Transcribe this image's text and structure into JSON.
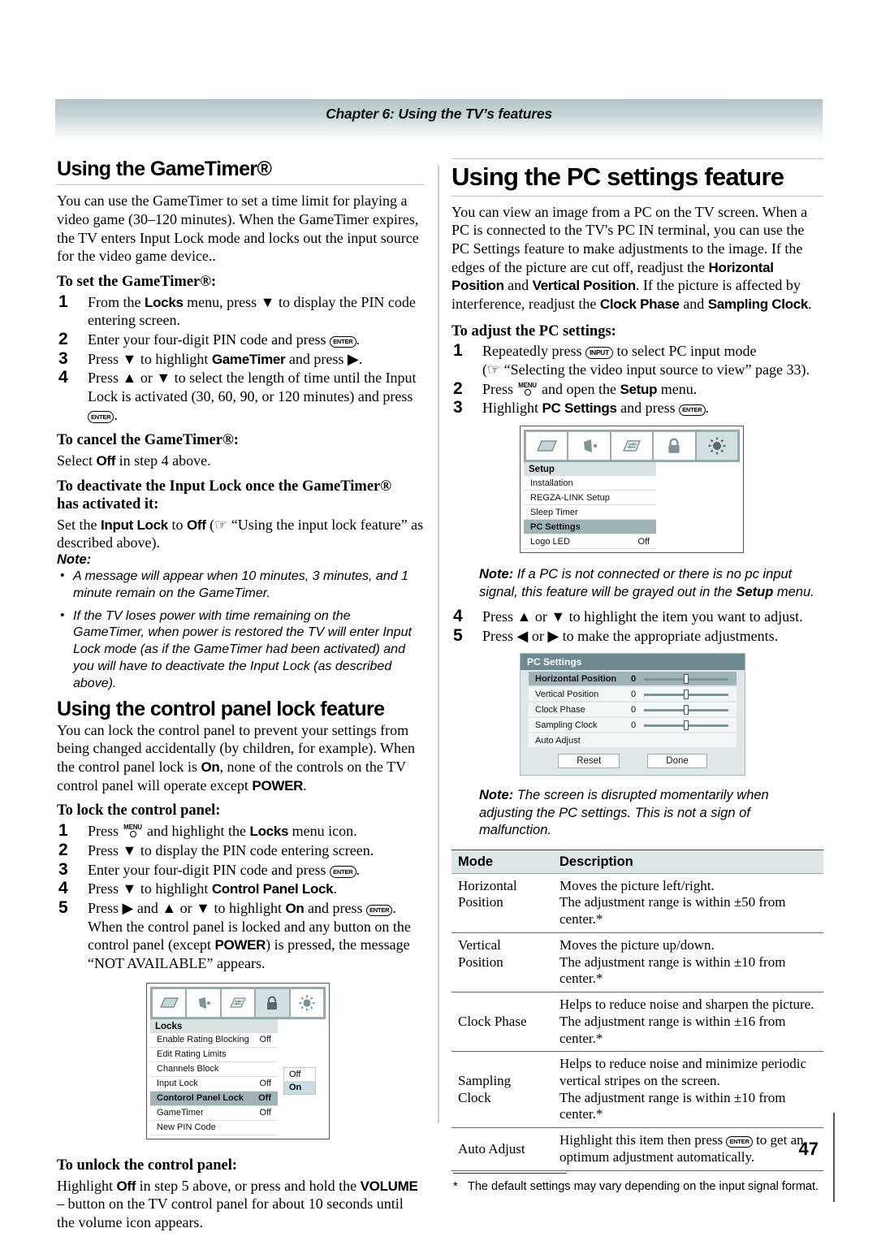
{
  "header": {
    "chapter_title": "Chapter 6: Using the TV’s features"
  },
  "page_number": "47",
  "left": {
    "gametimer": {
      "heading": "Using the GameTimer®",
      "intro": "You can use the GameTimer to set a time limit for playing a video game (30–120 minutes). When the GameTimer expires, the TV enters Input Lock mode and locks out the input source for the video game device..",
      "set_heading": "To set the GameTimer®:",
      "steps": [
        {
          "num": "1",
          "text_a": "From the ",
          "ui_a": "Locks",
          "text_b": " menu, press ▼ to display the PIN code entering screen."
        },
        {
          "num": "2",
          "text_a": "Enter your four-digit PIN code and press ",
          "key": "ENTER",
          "text_b": "."
        },
        {
          "num": "3",
          "text_a": "Press ▼ to highlight ",
          "ui_a": "GameTimer",
          "text_b": " and press ▶."
        },
        {
          "num": "4",
          "text_a": "Press ▲ or ▼ to select the length of time until the Input Lock is activated (30, 60, 90, or 120 minutes) and press ",
          "key": "ENTER",
          "text_b": "."
        }
      ],
      "cancel_heading": "To cancel the GameTimer®:",
      "cancel_text_a": "Select ",
      "cancel_ui": "Off",
      "cancel_text_b": " in step 4 above.",
      "deactivate_heading_line1": "To deactivate the Input Lock once the GameTimer®",
      "deactivate_heading_line2": "has activated it:",
      "deactivate_a": "Set the ",
      "deactivate_ui1": "Input Lock",
      "deactivate_b": " to ",
      "deactivate_ui2": "Off",
      "deactivate_c": " (☞ “Using the input lock feature” as described above).",
      "note_label": "Note:",
      "notes": [
        "A message will appear when 10 minutes, 3 minutes, and 1 minute remain on the GameTimer.",
        "If the TV loses power with time remaining on the GameTimer, when power is restored the TV will enter Input Lock mode (as if the GameTimer had been activated) and you will have to deactivate the Input Lock (as described above)."
      ]
    },
    "panel_lock": {
      "heading": "Using the control panel lock feature",
      "intro_a": "You can lock the control panel to prevent your settings from being changed accidentally (by children, for example). When the control panel lock is ",
      "intro_ui1": "On",
      "intro_b": ", none of the controls on the TV control panel will operate except ",
      "intro_ui2": "POWER",
      "intro_c": ".",
      "lock_heading": "To lock the control panel:",
      "steps": [
        {
          "num": "1",
          "text_a": "Press ",
          "key": "MENU",
          "text_b": " and highlight the ",
          "ui_a": "Locks",
          "text_c": " menu icon."
        },
        {
          "num": "2",
          "text_a": "Press ▼ to display the PIN code entering screen."
        },
        {
          "num": "3",
          "text_a": "Enter your four-digit PIN code and press ",
          "key": "ENTER",
          "text_b": "."
        },
        {
          "num": "4",
          "text_a": "Press ▼ to highlight ",
          "ui_a": "Control Panel Lock",
          "text_b": "."
        },
        {
          "num": "5",
          "text_a": "Press ▶ and ▲ or ▼ to highlight ",
          "ui_a": "On",
          "text_b": " and press ",
          "key": "ENTER",
          "text_c": ". When the control panel is locked and any button on the control panel (except ",
          "ui_b": "POWER",
          "text_d": ") is pressed, the message “NOT AVAILABLE” appears."
        }
      ],
      "unlock_heading": "To unlock the control panel:",
      "unlock_a": "Highlight ",
      "unlock_ui1": "Off",
      "unlock_b": " in step 5 above, or press and hold the ",
      "unlock_ui2": "VOLUME",
      "unlock_c": " – button on the TV control panel for about 10 seconds until the volume icon appears."
    },
    "locks_menu": {
      "title": "Locks",
      "icons": [
        "picture-icon",
        "audio-icon",
        "preferences-icon",
        "locks-icon",
        "setup-icon"
      ],
      "active_icon_index": 3,
      "rows": [
        {
          "label": "Enable Rating Blocking",
          "value": "Off",
          "selected": false
        },
        {
          "label": "Edit Rating Limits",
          "value": "",
          "selected": false
        },
        {
          "label": "Channels Block",
          "value": "",
          "selected": false
        },
        {
          "label": "Input Lock",
          "value": "Off",
          "selected": false
        },
        {
          "label": "Contorol Panel Lock",
          "value": "Off",
          "selected": true
        },
        {
          "label": "GameTimer",
          "value": "Off",
          "selected": false
        },
        {
          "label": "New PIN Code",
          "value": "",
          "selected": false
        }
      ],
      "popup": [
        {
          "label": "Off",
          "on": false
        },
        {
          "label": "On",
          "on": true
        }
      ]
    }
  },
  "right": {
    "pc_settings": {
      "heading": "Using the PC settings feature",
      "intro_a": "You can view an image from a PC on the TV screen. When a PC is connected to the TV's PC IN terminal, you can use the PC Settings feature to make adjustments to the image. If the edges of the picture are cut off, readjust the ",
      "intro_ui1": "Horizontal Position",
      "intro_b": " and ",
      "intro_ui2": "Vertical Position",
      "intro_c": ". If the picture is affected by interference, readjust the ",
      "intro_ui3": "Clock Phase",
      "intro_d": " and ",
      "intro_ui4": "Sampling Clock",
      "intro_e": ".",
      "adjust_heading": "To adjust the PC settings:",
      "steps": [
        {
          "num": "1",
          "text_a": "Repeatedly press ",
          "key": "INPUT",
          "text_b": " to select PC input mode",
          "text_c": "(☞ “Selecting the video input source to view” page 33)."
        },
        {
          "num": "2",
          "text_a": "Press ",
          "key": "MENU",
          "text_b": " and open the ",
          "ui_a": "Setup",
          "text_c": " menu."
        },
        {
          "num": "3",
          "text_a": "Highlight ",
          "ui_a": "PC Settings",
          "text_b": " and press ",
          "key": "ENTER",
          "text_c": "."
        },
        {
          "num": "4",
          "text_a": "Press ▲ or ▼ to highlight the item you want to adjust."
        },
        {
          "num": "5",
          "text_a": "Press ◀ or ▶ to make the appropriate adjustments."
        }
      ],
      "note1_label": "Note:",
      "note1_a": " If a PC is not connected or there is no pc input signal, this feature will be grayed out in the ",
      "note1_ui": "Setup",
      "note1_b": " menu.",
      "note2_label": "Note:",
      "note2_text": " The screen is disrupted momentarily when adjusting the PC settings. This is not a sign of malfunction."
    },
    "setup_menu": {
      "title": "Setup",
      "icons": [
        "picture-icon",
        "audio-icon",
        "preferences-icon",
        "locks-icon",
        "setup-icon"
      ],
      "active_icon_index": 4,
      "rows": [
        {
          "label": "Installation",
          "value": "",
          "selected": false
        },
        {
          "label": "REGZA-LINK Setup",
          "value": "",
          "selected": false
        },
        {
          "label": "Sleep Timer",
          "value": "",
          "selected": false
        },
        {
          "label": "PC Settings",
          "value": "",
          "selected": true
        },
        {
          "label": "Logo LED",
          "value": "Off",
          "selected": false
        }
      ]
    },
    "pc_dialog": {
      "title": "PC Settings",
      "rows": [
        {
          "label": "Horizontal Position",
          "value": "0",
          "has_slider": true,
          "selected": true
        },
        {
          "label": "Vertical Position",
          "value": "0",
          "has_slider": true,
          "selected": false
        },
        {
          "label": "Clock Phase",
          "value": "0",
          "has_slider": true,
          "selected": false
        },
        {
          "label": "Sampling Clock",
          "value": "0",
          "has_slider": true,
          "selected": false
        },
        {
          "label": "Auto Adjust",
          "value": "",
          "has_slider": false,
          "selected": false
        }
      ],
      "reset_label": "Reset",
      "done_label": "Done"
    },
    "mode_table": {
      "headers": [
        "Mode",
        "Description"
      ],
      "rows": [
        {
          "mode": "Horizontal\nPosition",
          "desc_lines": [
            "Moves the picture left/right.",
            "The adjustment range is within ±50 from center.*"
          ]
        },
        {
          "mode": "Vertical\nPosition",
          "desc_lines": [
            "Moves the picture up/down.",
            "The adjustment range is within ±10 from center.*"
          ]
        },
        {
          "mode": "Clock Phase",
          "desc_lines": [
            "Helps to reduce noise and sharpen the picture.",
            "The adjustment range is within ±16 from center.*"
          ]
        },
        {
          "mode": "Sampling\nClock",
          "desc_lines": [
            "Helps to reduce noise and minimize periodic vertical stripes on the screen.",
            "The adjustment range is within ±10 from center.*"
          ]
        },
        {
          "mode": "Auto Adjust",
          "desc_lines": [
            "Highlight this item then press [ENTER] to get an optimum adjustment automatically."
          ]
        }
      ],
      "footnote_star": "*",
      "footnote_text": "The default settings may vary depending on the input signal format."
    }
  }
}
